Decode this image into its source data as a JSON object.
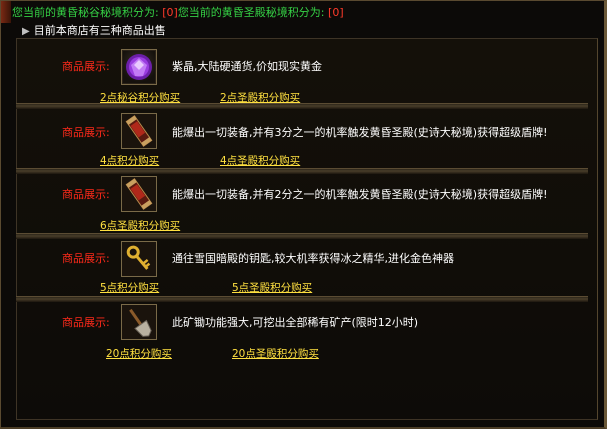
{
  "header": {
    "text_a": "您当前的黄昏秘谷秘境积分为:",
    "value_a": "[0]",
    "text_b": "您当前的黄昏圣殿秘境积分为:",
    "value_b": "[0]"
  },
  "shop": {
    "intro": "目前本商店有三种商品出售",
    "show_label": "商品展示:"
  },
  "items": [
    {
      "icon": "purple-gem-icon",
      "desc": "紫晶,大陆硬通货,价如现实黄金",
      "buy_a": "2点秘谷积分购买",
      "buy_b": "2点圣殿积分购买"
    },
    {
      "icon": "red-scroll-icon",
      "desc": "能爆出一切装备,并有3分之一的机率触发黄昏圣殿(史诗大秘境)获得超级盾牌!",
      "buy_a": "4点积分购买",
      "buy_b": "4点圣殿积分购买"
    },
    {
      "icon": "red-scroll-icon",
      "desc": "能爆出一切装备,并有2分之一的机率触发黄昏圣殿(史诗大秘境)获得超级盾牌!",
      "buy_a": "6点圣殿积分购买"
    },
    {
      "icon": "golden-key-icon",
      "desc": "通往雪国暗殿的钥匙,较大机率获得冰之精华,进化金色神器",
      "buy_a": "5点积分购买",
      "buy_b": "5点圣殿积分购买"
    },
    {
      "icon": "shovel-icon",
      "desc": "此矿锄功能强大,可挖出全部稀有矿产(限时12小时)",
      "buy_a": "20点积分购买",
      "buy_b": "20点圣殿积分购买"
    }
  ]
}
